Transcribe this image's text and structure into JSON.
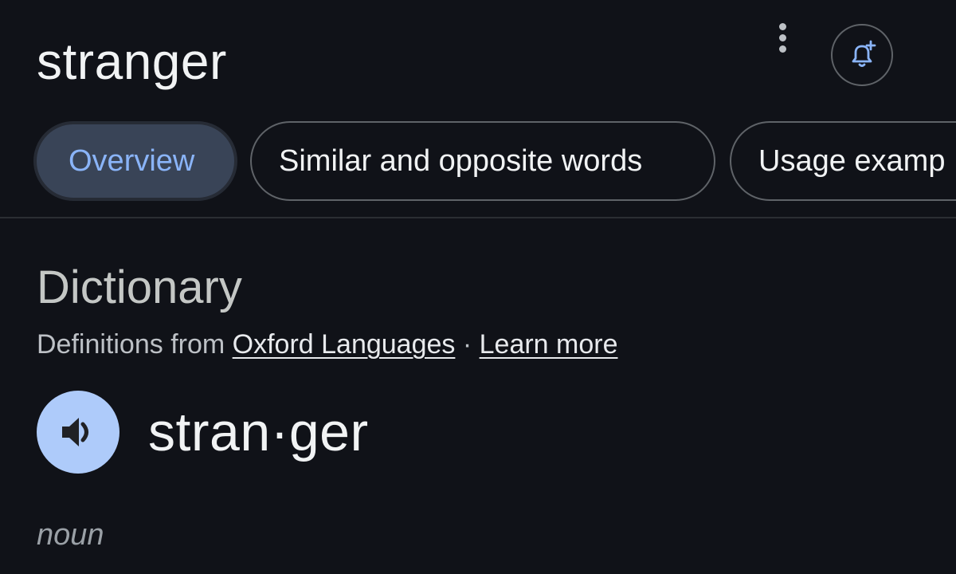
{
  "query": "stranger",
  "header": {
    "more_icon": "more-vert-icon",
    "alert_icon": "bell-plus-icon",
    "accent_color": "#8ab4f8"
  },
  "tabs": [
    {
      "label": "Overview",
      "active": true
    },
    {
      "label": "Similar and opposite words",
      "active": false
    },
    {
      "label": "Usage examp",
      "active": false
    }
  ],
  "dictionary": {
    "title": "Dictionary",
    "attribution_prefix": "Definitions from ",
    "source_link": "Oxford Languages",
    "separator": " · ",
    "learn_more": "Learn more",
    "headword": "stran·ger",
    "speaker_icon": "volume-icon",
    "part_of_speech": "noun"
  }
}
